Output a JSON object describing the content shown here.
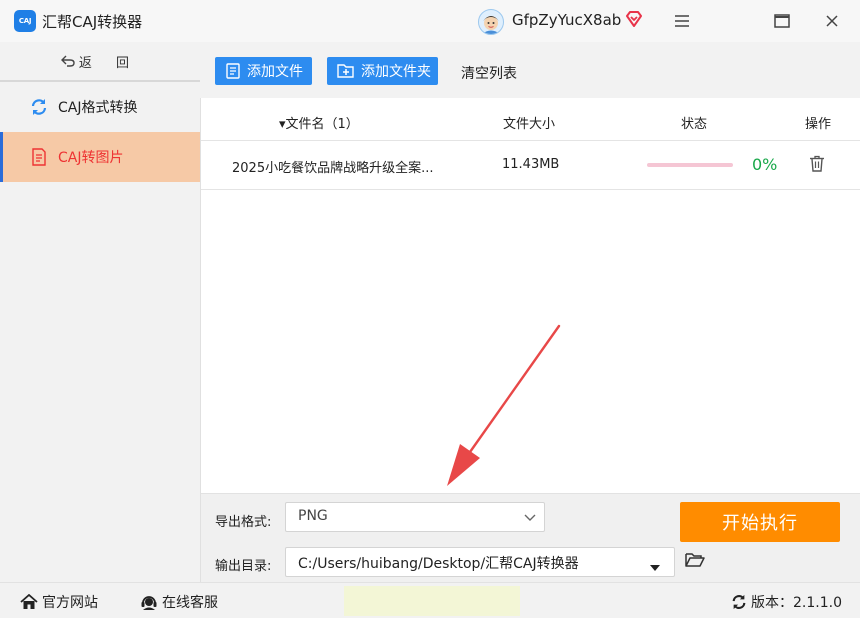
{
  "app": {
    "logo_text": "CAJ",
    "title": "汇帮CAJ转换器",
    "username": "GfpZyYucX8ab",
    "icons": {
      "logo": "caj-app-icon",
      "avatar": "user-avatar",
      "vip": "vip-diamond-icon",
      "menu": "hamburger-menu-icon",
      "maximize": "maximize-icon",
      "close": "close-icon"
    }
  },
  "sidebar": {
    "back_label": "返 回",
    "items": [
      {
        "label": "CAJ格式转换",
        "icon": "refresh-icon",
        "active": false
      },
      {
        "label": "CAJ转图片",
        "icon": "document-icon",
        "active": true
      }
    ]
  },
  "toolbar": {
    "add_file_label": "添加文件",
    "add_folder_label": "添加文件夹",
    "clear_list_label": "清空列表"
  },
  "table": {
    "headers": {
      "name": "▾文件名（1）",
      "size": "文件大小",
      "status": "状态",
      "action": "操作"
    },
    "rows": [
      {
        "name": "2025小吃餐饮品牌战略升级全案...",
        "size": "11.43MB",
        "progress": 0,
        "progress_text": "0%"
      }
    ]
  },
  "settings": {
    "format_label": "导出格式:",
    "format_value": "PNG",
    "output_label": "输出目录:",
    "output_value": "C:/Users/huibang/Desktop/汇帮CAJ转换器",
    "start_label": "开始执行"
  },
  "footer": {
    "official_site": "官方网站",
    "online_service": "在线客服",
    "version_label": "版本：2.1.1.0"
  },
  "colors": {
    "primary": "#2d8cf0",
    "start": "#ff8c00",
    "active_item_bg": "#f6c9a6",
    "active_item_text": "#ee3333",
    "progress_text": "#19a84a",
    "arrow": "#e84848"
  }
}
